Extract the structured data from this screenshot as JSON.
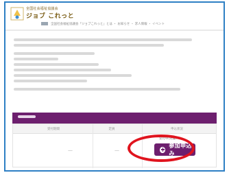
{
  "header": {
    "logo_small": "全国社会福祉協議会",
    "logo_big": "ジョブ これっと",
    "breadcrumb": "全国社会福祉協議会「ジョブこれっと」とは ・ お知らせ ・ 求人情報 ・ イベント"
  },
  "table": {
    "columns": [
      "受付期間",
      "定員",
      "申込状況"
    ],
    "row": [
      "—",
      "—"
    ],
    "status_note": "受付中(先着)"
  },
  "apply_button": {
    "label": "参加申込み",
    "icon": "plus-circle-icon"
  },
  "colors": {
    "frame": "#2d7fc4",
    "accent": "#6d1f6e",
    "highlight": "#e0141e"
  }
}
